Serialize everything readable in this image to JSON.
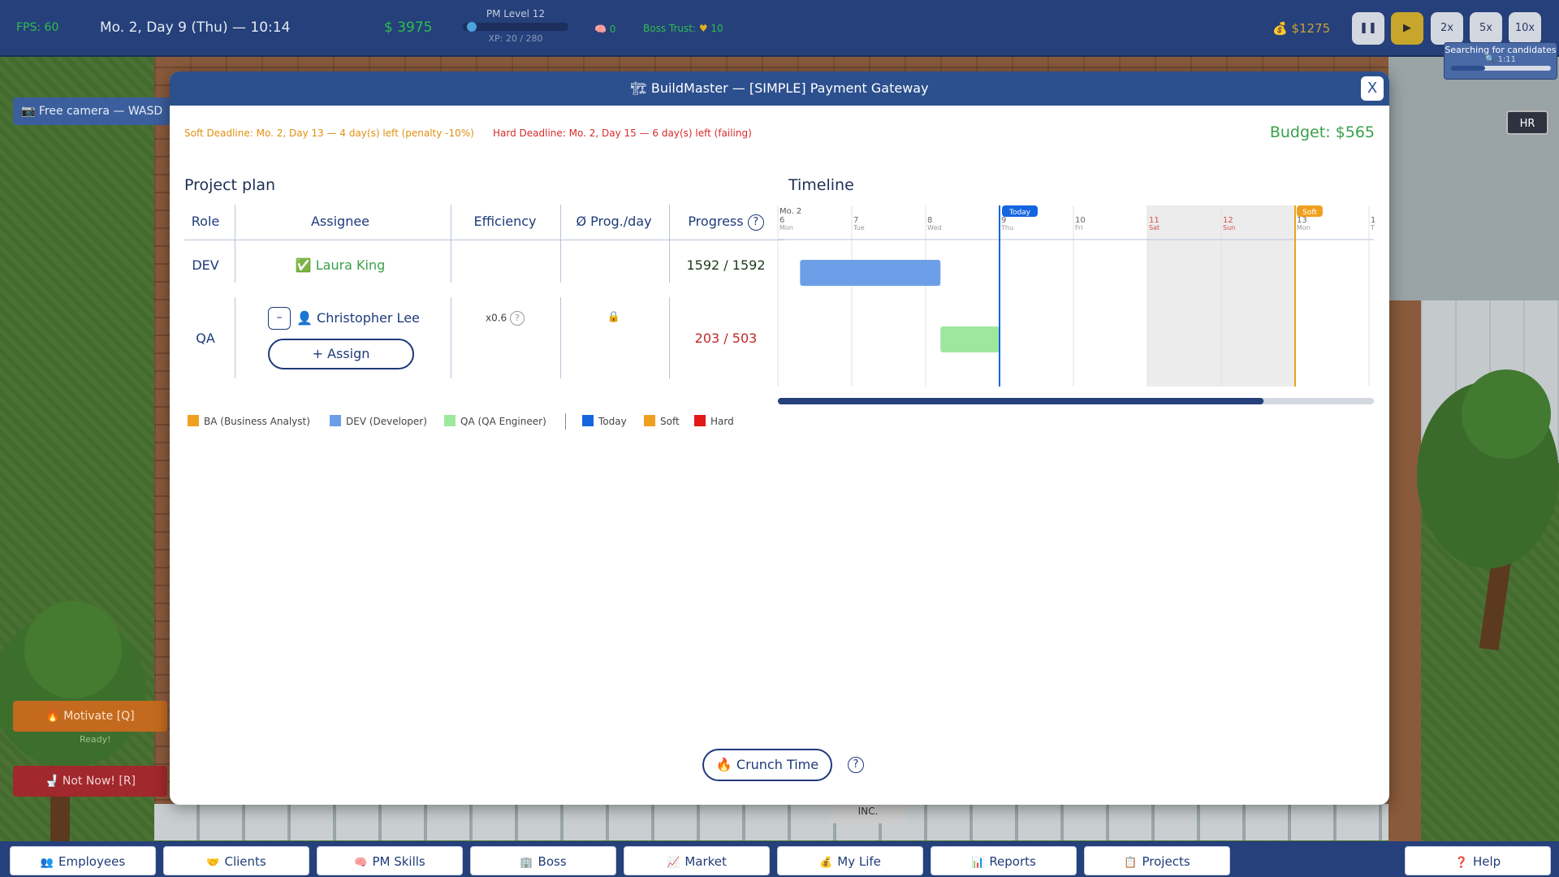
{
  "hud": {
    "fps": "FPS: 60",
    "date": "Mo. 2, Day 9 (Thu) — 10:14",
    "money": "$ 3975",
    "pm_level": "PM Level 12",
    "pm_xp": "XP: 20 / 280",
    "pm_xp_progress": 0.07,
    "brain_value": "0",
    "boss_trust_label": "Boss Trust:",
    "boss_trust_value": "10",
    "wallet": "$1275",
    "speed_buttons": [
      "2x",
      "5x",
      "10x"
    ],
    "search_title": "Searching for candidates",
    "search_time": "1:11",
    "search_progress": 0.35
  },
  "scene": {
    "free_camera": "Free camera — WASD",
    "hr_label": "HR",
    "motivate_label": "Motivate [Q]",
    "motivate_status": "Ready!",
    "notnow_label": "Not Now! [R]",
    "sign_text": "INC."
  },
  "nav": {
    "items": [
      {
        "label": "Employees",
        "icon": "people-icon"
      },
      {
        "label": "Clients",
        "icon": "handshake-icon"
      },
      {
        "label": "PM Skills",
        "icon": "brain-icon"
      },
      {
        "label": "Boss",
        "icon": "building-icon"
      },
      {
        "label": "Market",
        "icon": "chart-icon"
      },
      {
        "label": "My Life",
        "icon": "money-bag-icon"
      },
      {
        "label": "Reports",
        "icon": "bar-chart-icon"
      },
      {
        "label": "Projects",
        "icon": "clipboard-icon"
      }
    ],
    "help": "Help"
  },
  "modal": {
    "title": "BuildMaster  —  [SIMPLE] Payment Gateway",
    "close": "X",
    "soft_deadline": "Soft Deadline: Mo. 2, Day 13 — 4 day(s) left (penalty -10%)",
    "hard_deadline": "Hard Deadline: Mo. 2, Day 15 — 6 day(s) left (failing)",
    "budget": "Budget: $565",
    "plan_title": "Project plan",
    "timeline_title": "Timeline",
    "columns": {
      "role": "Role",
      "assignee": "Assignee",
      "efficiency": "Efficiency",
      "prog_day": "Ø Prog./day",
      "progress": "Progress",
      "help": "?"
    },
    "rows": [
      {
        "role": "DEV",
        "assignee": "Laura King",
        "efficiency": "",
        "prog_day": "",
        "progress": "1592 / 1592"
      },
      {
        "role": "QA",
        "assignee": "Christopher Lee",
        "efficiency": "x0.6",
        "efficiency_help": "?",
        "prog_day": "locked",
        "progress": "203 / 503",
        "remove": "–",
        "assign": "+ Assign"
      }
    ],
    "legend": [
      {
        "label": "BA (Business Analyst)",
        "color": "#f0a020"
      },
      {
        "label": "DEV (Developer)",
        "color": "#6d9ee8"
      },
      {
        "label": "QA (QA Engineer)",
        "color": "#9ee89e"
      },
      {
        "label": "Today",
        "color": "#1565e0"
      },
      {
        "label": "Soft",
        "color": "#f0a020"
      },
      {
        "label": "Hard",
        "color": "#e01818"
      }
    ],
    "crunch": "Crunch Time",
    "crunch_help": "?"
  },
  "chart_data": {
    "type": "gantt",
    "month_label": "Mo. 2",
    "days": [
      {
        "day": "6",
        "weekday": "Mon",
        "weekend": false
      },
      {
        "day": "7",
        "weekday": "Tue",
        "weekend": false
      },
      {
        "day": "8",
        "weekday": "Wed",
        "weekend": false
      },
      {
        "day": "9",
        "weekday": "Thu",
        "weekend": false
      },
      {
        "day": "10",
        "weekday": "Fri",
        "weekend": false
      },
      {
        "day": "11",
        "weekday": "Sat",
        "weekend": true
      },
      {
        "day": "12",
        "weekday": "Sun",
        "weekend": true
      },
      {
        "day": "13",
        "weekday": "Mon",
        "weekend": false
      },
      {
        "day": "1",
        "weekday": "T",
        "weekend": false
      }
    ],
    "bars": [
      {
        "role": "DEV",
        "start": 6.3,
        "end": 8.2,
        "color": "#6d9ee8"
      },
      {
        "role": "QA",
        "start": 8.2,
        "end": 9.0,
        "color": "#9ee89e"
      }
    ],
    "today": 9.0,
    "today_label": "Today",
    "soft_deadline": 13.0,
    "soft_label": "Soft",
    "today_color": "#1565e0",
    "soft_color": "#f0a020",
    "scroll_position": 0.815
  }
}
